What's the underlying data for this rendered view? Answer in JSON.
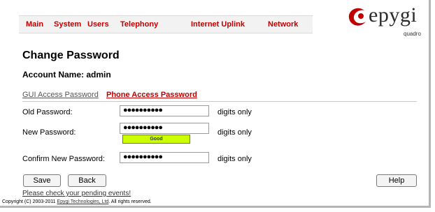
{
  "nav": {
    "items": [
      "Main",
      "System",
      "Users",
      "Telephony",
      "Internet Uplink",
      "Network"
    ]
  },
  "logo": {
    "brand": "epygi",
    "sub": "quadro"
  },
  "page": {
    "title": "Change Password",
    "account": "Account Name: admin"
  },
  "tabs": {
    "gui": "GUI Access Password",
    "phone": "Phone Access Password"
  },
  "form": {
    "old_label": "Old Password:",
    "old_value": "●●●●●●●●●●",
    "new_label": "New Password:",
    "new_value": "●●●●●●●●●●",
    "confirm_label": "Confirm New Password:",
    "confirm_value": "●●●●●●●●●●",
    "hint": "digits only",
    "strength": "Good"
  },
  "buttons": {
    "save": "Save",
    "back": "Back",
    "help": "Help"
  },
  "footer": {
    "pending": "Please check your pending events!",
    "copyright_pre": "Copyright (C) 2003-2011 ",
    "company": "Epygi Technologies, Ltd",
    "copyright_post": ". All rights reserved."
  }
}
